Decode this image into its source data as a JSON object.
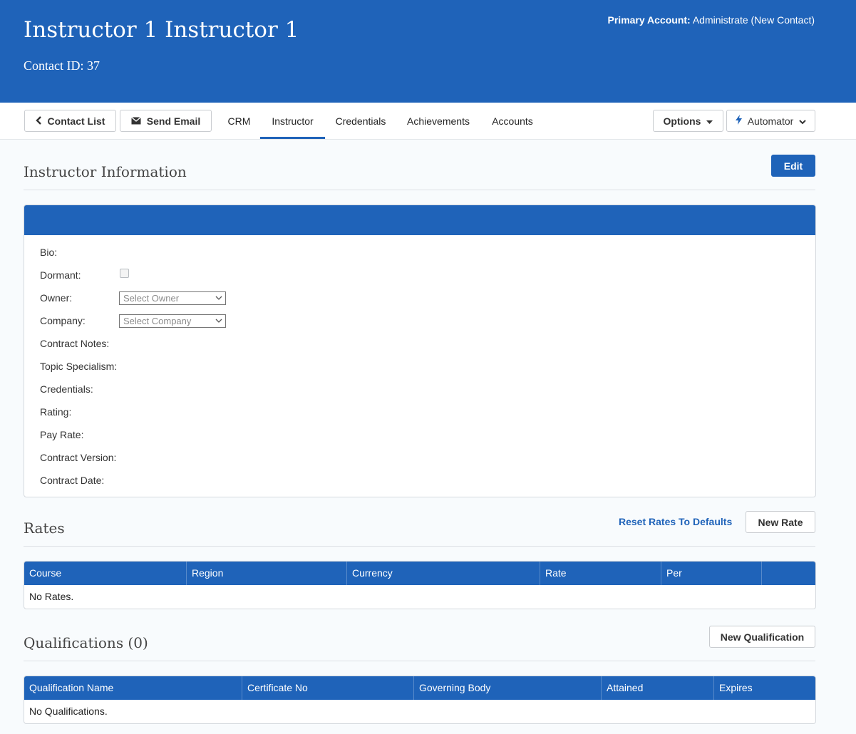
{
  "header": {
    "name": "Instructor 1 Instructor 1",
    "contact_id": "Contact ID: 37",
    "primary_account_label": "Primary Account:",
    "primary_account_value": "Administrate (New Contact)"
  },
  "toolbar": {
    "contact_list": "Contact List",
    "send_email": "Send Email",
    "options": "Options",
    "automator": "Automator"
  },
  "tabs": [
    {
      "label": "CRM"
    },
    {
      "label": "Instructor"
    },
    {
      "label": "Credentials"
    },
    {
      "label": "Achievements"
    },
    {
      "label": "Accounts"
    }
  ],
  "instructor": {
    "title": "Instructor Information",
    "edit": "Edit",
    "fields": {
      "bio": "Bio:",
      "dormant": "Dormant:",
      "owner": "Owner:",
      "company": "Company:",
      "contract_notes": "Contract Notes:",
      "topic_specialism": "Topic Specialism:",
      "credentials": "Credentials:",
      "rating": "Rating:",
      "pay_rate": "Pay Rate:",
      "contract_version": "Contract Version:",
      "contract_date": "Contract Date:"
    },
    "owner_placeholder": "Select Owner",
    "company_placeholder": "Select Company"
  },
  "rates": {
    "title": "Rates",
    "reset_link": "Reset Rates To Defaults",
    "new_button": "New Rate",
    "columns": [
      "Course",
      "Region",
      "Currency",
      "Rate",
      "Per"
    ],
    "empty": "No Rates."
  },
  "qualifications": {
    "title": "Qualifications (0)",
    "new_button": "New Qualification",
    "columns": [
      "Qualification Name",
      "Certificate No",
      "Governing Body",
      "Attained",
      "Expires"
    ],
    "empty": "No Qualifications."
  },
  "colors": {
    "brand": "#1f63b9"
  }
}
